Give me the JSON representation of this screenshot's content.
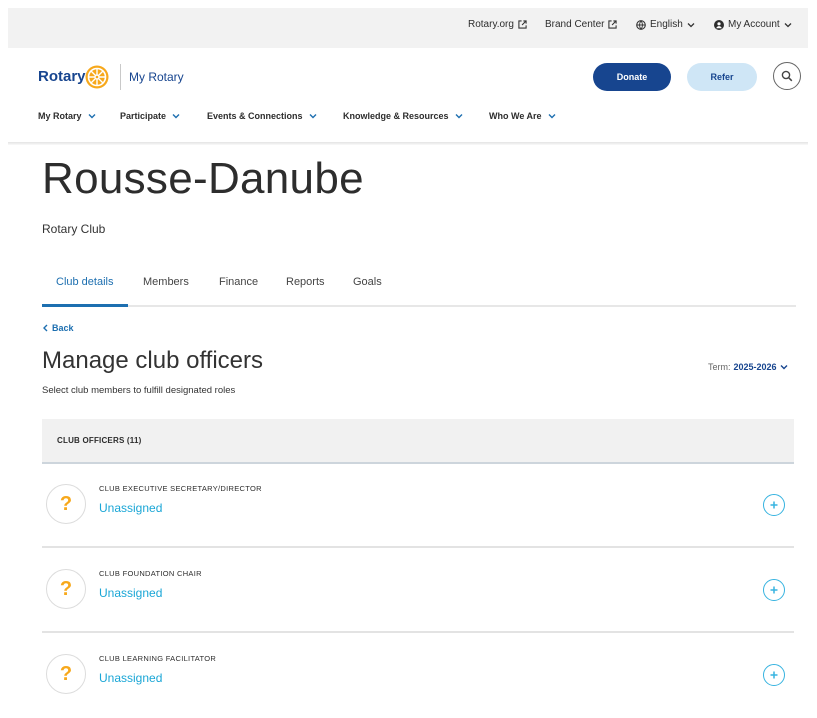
{
  "utility": {
    "rotary_org": "Rotary.org",
    "brand_center": "Brand Center",
    "language": "English",
    "account": "My Account"
  },
  "header": {
    "logo": "Rotary",
    "site_name": "My Rotary",
    "donate_label": "Donate",
    "refer_label": "Refer"
  },
  "nav": [
    "My Rotary",
    "Participate",
    "Events & Connections",
    "Knowledge & Resources",
    "Who We Are"
  ],
  "club": {
    "name": "Rousse-Danube",
    "type": "Rotary Club"
  },
  "tabs": [
    "Club details",
    "Members",
    "Finance",
    "Reports",
    "Goals"
  ],
  "active_tab": "Club details",
  "back_label": "Back",
  "section": {
    "title": "Manage club officers",
    "subtitle": "Select club members to fulfill designated roles",
    "term_label": "Term:",
    "term_value": "2025-2026"
  },
  "officers_header": "CLUB OFFICERS (11)",
  "officers": [
    {
      "role": "CLUB EXECUTIVE SECRETARY/DIRECTOR",
      "status": "Unassigned",
      "avatar": "?"
    },
    {
      "role": "CLUB FOUNDATION CHAIR",
      "status": "Unassigned",
      "avatar": "?"
    },
    {
      "role": "CLUB LEARNING FACILITATOR",
      "status": "Unassigned",
      "avatar": "?"
    }
  ],
  "colors": {
    "brand_blue": "#17458f",
    "gold": "#f7a81b",
    "link_blue": "#1d6fb0",
    "sky": "#36b3e0",
    "refer_bg": "#cfe6f6"
  }
}
